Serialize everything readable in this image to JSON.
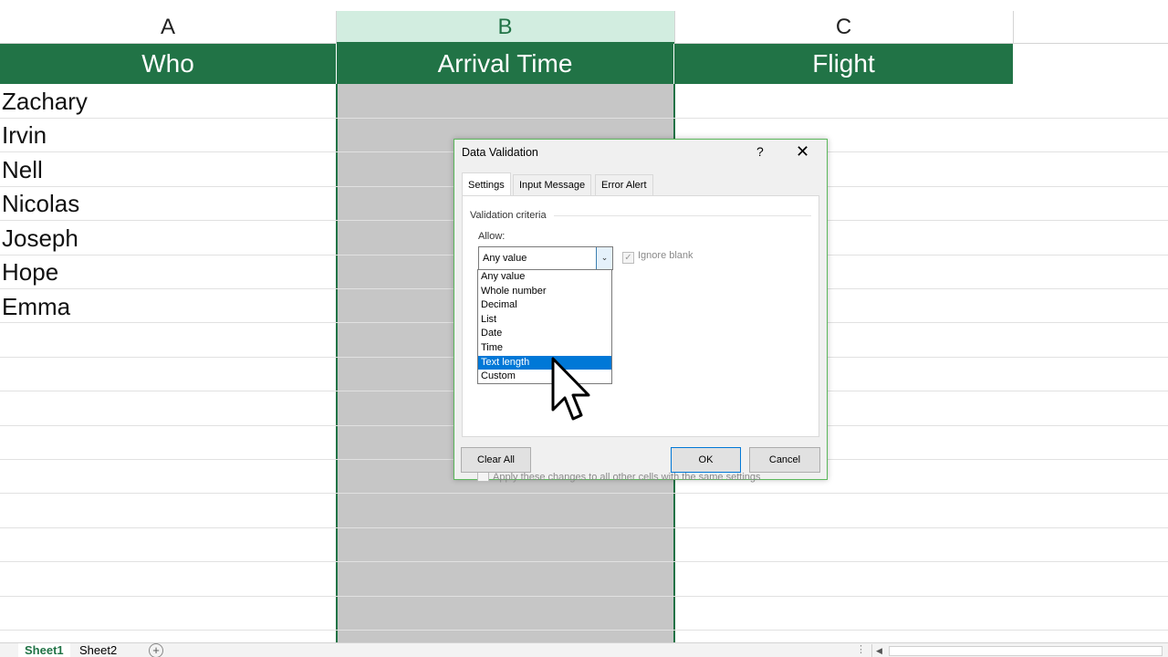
{
  "columns": {
    "a": "A",
    "b": "B",
    "c": "C"
  },
  "table": {
    "headers": [
      "Who",
      "Arrival Time",
      "Flight"
    ],
    "names": [
      "Zachary",
      "Irvin",
      "Nell",
      "Nicolas",
      "Joseph",
      "Hope",
      "Emma"
    ]
  },
  "dialog": {
    "title": "Data Validation",
    "help": "?",
    "close": "✕",
    "tabs": [
      "Settings",
      "Input Message",
      "Error Alert"
    ],
    "criteria_label": "Validation criteria",
    "allow_label": "Allow:",
    "allow_value": "Any value",
    "ignore_blank": "Ignore blank",
    "options": [
      "Any value",
      "Whole number",
      "Decimal",
      "List",
      "Date",
      "Time",
      "Text length",
      "Custom"
    ],
    "highlighted_option": "Text length",
    "apply_text": "Apply these changes to all other cells with the same settings",
    "clear_all": "Clear All",
    "ok": "OK",
    "cancel": "Cancel"
  },
  "sheets": [
    "Sheet1",
    "Sheet2"
  ],
  "add_sheet": "+"
}
